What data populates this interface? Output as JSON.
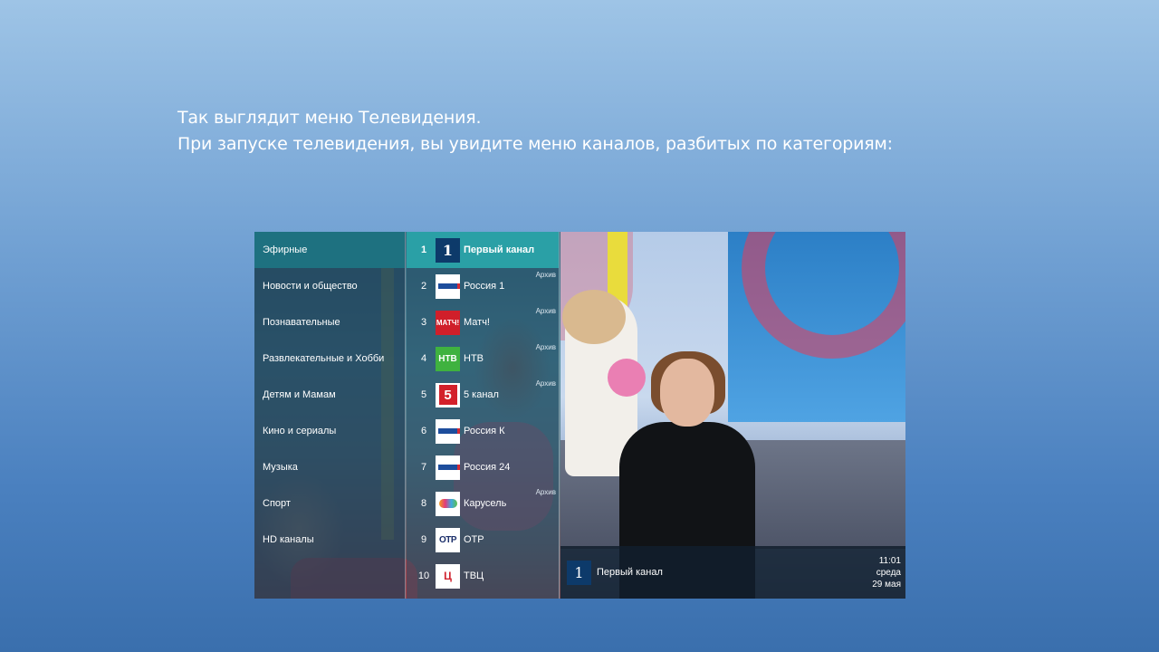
{
  "caption": {
    "line1": "Так выглядит меню Телевидения.",
    "line2": "При запуске телевидения, вы увидите меню каналов, разбитых по категориям:"
  },
  "categories": [
    {
      "label": "Эфирные",
      "active": true
    },
    {
      "label": "Новости и общество"
    },
    {
      "label": "Познавательные"
    },
    {
      "label": "Развлекательные и Хобби"
    },
    {
      "label": "Детям и Мамам"
    },
    {
      "label": "Кино и сериалы"
    },
    {
      "label": "Музыка"
    },
    {
      "label": "Спорт"
    },
    {
      "label": "HD каналы"
    }
  ],
  "channels": [
    {
      "num": "1",
      "name": "Первый канал",
      "logo": "perviy-kanal-icon",
      "archive": "",
      "active": true
    },
    {
      "num": "2",
      "name": "Россия 1",
      "logo": "rossiya-1-icon",
      "archive": "Архив"
    },
    {
      "num": "3",
      "name": "Матч!",
      "logo": "match-icon",
      "logo_text": "МАТЧ!",
      "archive": "Архив"
    },
    {
      "num": "4",
      "name": "НТВ",
      "logo": "ntv-icon",
      "logo_text": "НТВ",
      "archive": "Архив"
    },
    {
      "num": "5",
      "name": "5 канал",
      "logo": "5-kanal-icon",
      "logo_text": "5",
      "archive": "Архив"
    },
    {
      "num": "6",
      "name": "Россия К",
      "logo": "rossiya-k-icon",
      "archive": ""
    },
    {
      "num": "7",
      "name": "Россия 24",
      "logo": "rossiya-24-icon",
      "archive": ""
    },
    {
      "num": "8",
      "name": "Карусель",
      "logo": "karusel-icon",
      "archive": "Архив"
    },
    {
      "num": "9",
      "name": "ОТР",
      "logo": "otr-icon",
      "logo_text": "ОТР",
      "archive": ""
    },
    {
      "num": "10",
      "name": "ТВЦ",
      "logo": "tvc-icon",
      "logo_text": "Ц",
      "archive": ""
    }
  ],
  "now_playing": {
    "channel": "Первый канал",
    "time": "11:01",
    "weekday": "среда",
    "date": "29 мая"
  },
  "colors": {
    "active_category": "#1e7180",
    "active_channel": "#2aa0a6"
  }
}
